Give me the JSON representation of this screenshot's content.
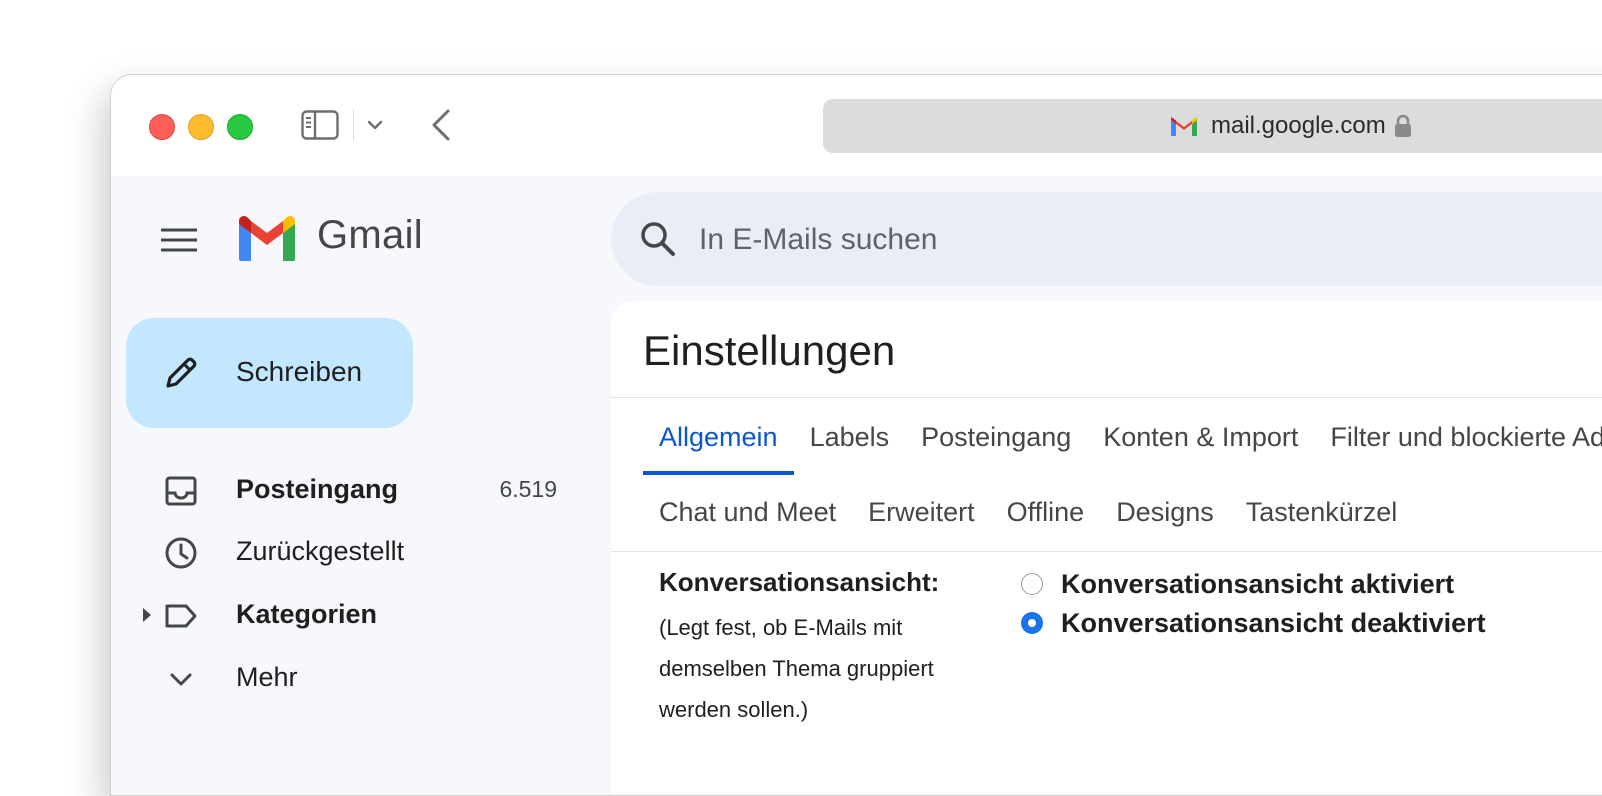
{
  "browser": {
    "url": "mail.google.com"
  },
  "app": {
    "name": "Gmail"
  },
  "search": {
    "placeholder": "In E-Mails suchen"
  },
  "compose": {
    "label": "Schreiben"
  },
  "nav": {
    "items": [
      {
        "label": "Posteingang",
        "count": "6.519",
        "bold": true,
        "icon": "inbox-icon"
      },
      {
        "label": "Zurückgestellt",
        "count": "",
        "bold": false,
        "icon": "clock-icon"
      },
      {
        "label": "Kategorien",
        "count": "",
        "bold": true,
        "icon": "label-icon"
      },
      {
        "label": "Mehr",
        "count": "",
        "bold": false,
        "icon": "chevron-down-icon"
      }
    ]
  },
  "settings": {
    "title": "Einstellungen",
    "tabs_row1": [
      "Allgemein",
      "Labels",
      "Posteingang",
      "Konten & Import",
      "Filter und blockierte Adressen"
    ],
    "tabs_row2": [
      "Chat und Meet",
      "Erweitert",
      "Offline",
      "Designs",
      "Tastenkürzel"
    ],
    "active_tab": "Allgemein",
    "conversation_view": {
      "label": "Konversationsansicht:",
      "description": "(Legt fest, ob E-Mails mit demselben Thema gruppiert werden sollen.)",
      "options": [
        {
          "label": "Konversationsansicht aktiviert",
          "checked": false
        },
        {
          "label": "Konversationsansicht deaktiviert",
          "checked": true
        }
      ]
    }
  },
  "colors": {
    "accent": "#0b57d0",
    "compose_bg": "#c2e7ff",
    "search_bg": "#e9eef6",
    "sidebar_bg": "#f6f8fc",
    "radio_checked": "#1a73e8"
  }
}
